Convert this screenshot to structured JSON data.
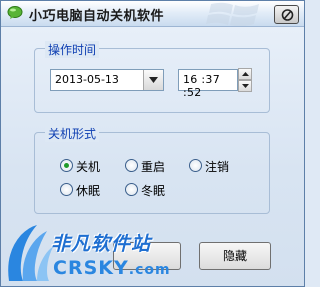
{
  "window": {
    "title": "小巧电脑自动关机软件"
  },
  "operation_time": {
    "group_label": "操作时间",
    "date": "2013-05-13",
    "time": "16 :37 :52"
  },
  "shutdown_mode": {
    "group_label": "关机形式",
    "options": [
      {
        "label": "关机",
        "selected": true
      },
      {
        "label": "重启",
        "selected": false
      },
      {
        "label": "注销",
        "selected": false
      },
      {
        "label": "休眠",
        "selected": false
      },
      {
        "label": "冬眠",
        "selected": false
      }
    ]
  },
  "buttons": {
    "hide": "隐藏"
  },
  "watermark": {
    "cn_text": "非凡软件站",
    "en_text": "CRSKY",
    "suffix": ".com"
  },
  "colors": {
    "group_label": "#0e3fb2",
    "radio_selected": "#1f9a2a",
    "watermark": "#2a86e0"
  }
}
